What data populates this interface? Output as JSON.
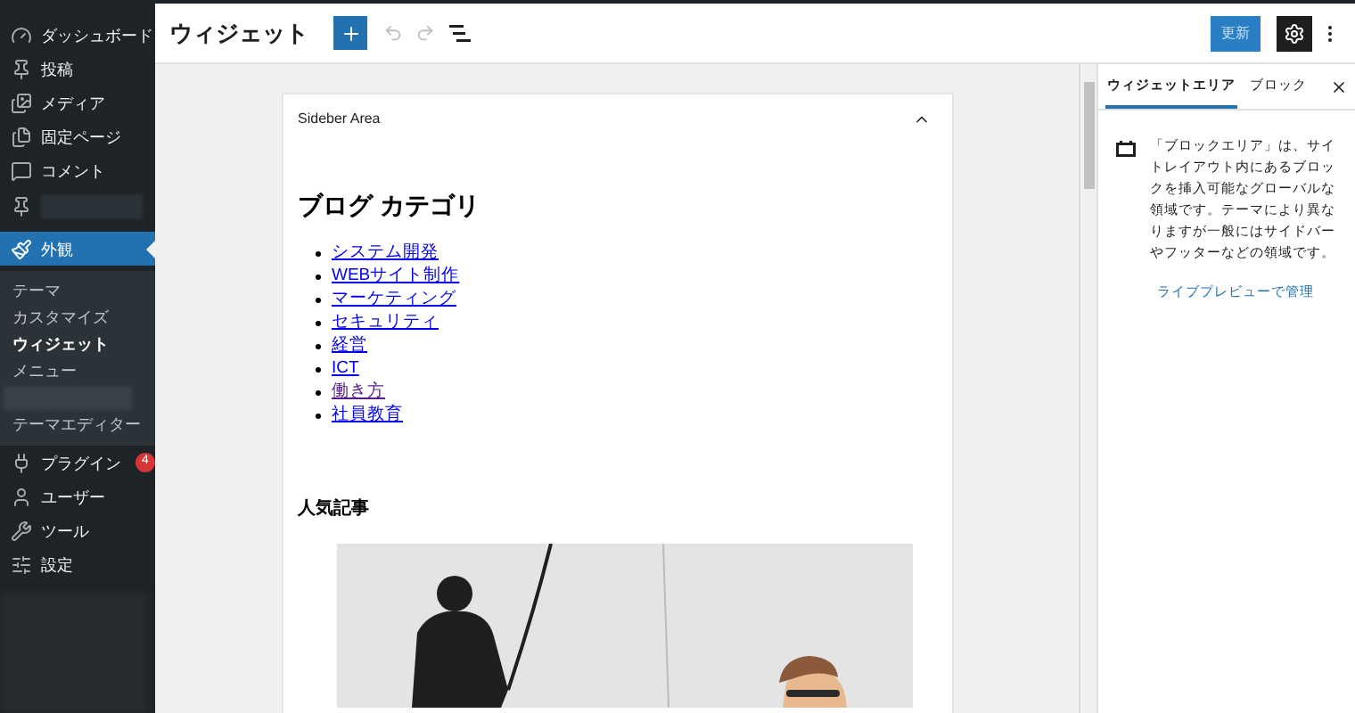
{
  "sidebar": {
    "items": [
      {
        "kind": "item",
        "label": "ダッシュボード",
        "selected": false
      },
      {
        "kind": "item",
        "label": "投稿",
        "selected": false
      },
      {
        "kind": "item",
        "label": "メディア",
        "selected": false
      },
      {
        "kind": "item",
        "label": "固定ページ",
        "selected": false
      },
      {
        "kind": "item",
        "label": "コメント",
        "selected": false
      },
      {
        "kind": "redacted"
      },
      {
        "kind": "item",
        "label": "外観",
        "selected": true,
        "children": [
          {
            "kind": "item",
            "label": "テーマ",
            "selected": false
          },
          {
            "kind": "item",
            "label": "カスタマイズ",
            "selected": false
          },
          {
            "kind": "item",
            "label": "ウィジェット",
            "selected": true
          },
          {
            "kind": "item",
            "label": "メニュー",
            "selected": false
          },
          {
            "kind": "redacted"
          },
          {
            "kind": "item",
            "label": "テーマエディター",
            "selected": false
          }
        ]
      },
      {
        "kind": "item",
        "label": "プラグイン",
        "badge": "4",
        "selected": false
      },
      {
        "kind": "item",
        "label": "ユーザー",
        "selected": false
      },
      {
        "kind": "item",
        "label": "ツール",
        "selected": false
      },
      {
        "kind": "item",
        "label": "設定",
        "selected": false
      }
    ]
  },
  "header": {
    "title": "ウィジェット",
    "undo_disabled": true,
    "redo_disabled": true,
    "update_button": "更新",
    "settings_active": true
  },
  "widget_area": {
    "title": "Sideber Area",
    "expanded": true,
    "category_heading": "ブログ カテゴリ",
    "categories": [
      {
        "label": "システム開発",
        "visited": false
      },
      {
        "label": "WEBサイト制作",
        "visited": false
      },
      {
        "label": "マーケティング",
        "visited": false
      },
      {
        "label": "セキュリティ",
        "visited": false
      },
      {
        "label": "経営",
        "visited": false
      },
      {
        "label": "ICT",
        "visited": false
      },
      {
        "label": "働き方",
        "visited": true
      },
      {
        "label": "社員教育",
        "visited": false
      }
    ],
    "popular_heading": "人気記事"
  },
  "panel": {
    "tabs": [
      {
        "label": "ウィジェットエリア",
        "selected": true
      },
      {
        "label": "ブロック",
        "selected": false
      }
    ],
    "description": "「ブロックエリア」は、サイトレイアウト内にあるブロックを挿入可能なグローバルな領域です。テーマにより異なりますが一般にはサイドバーやフッターなどの領域です。",
    "link": "ライブプレビューで管理"
  }
}
